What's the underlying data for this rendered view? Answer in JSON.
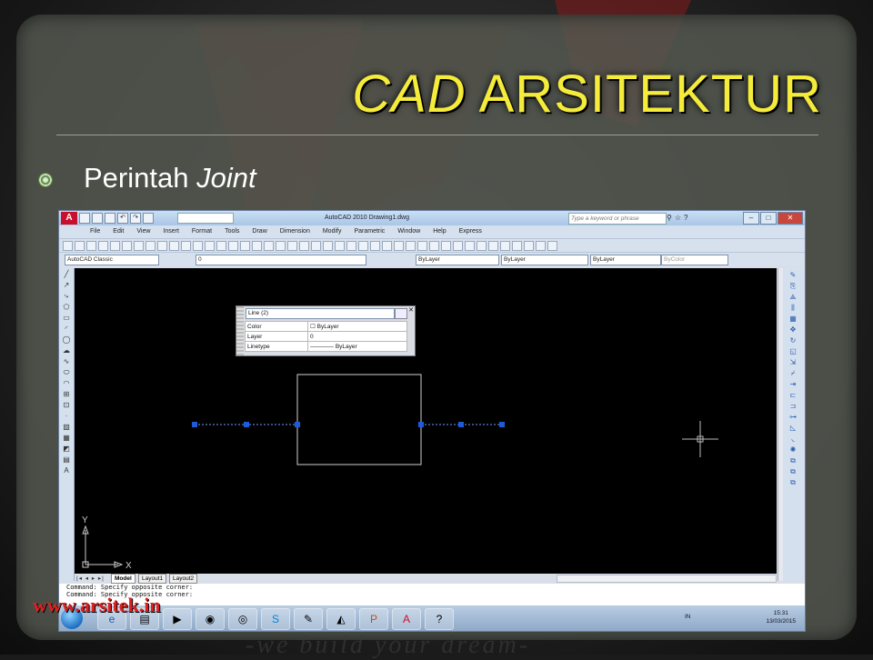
{
  "slide": {
    "title_italic": "CAD",
    "title_rest": "ARSITEKTUR",
    "bullet_text": "Perintah",
    "bullet_italic": "Joint"
  },
  "autocad": {
    "app_logo": "A",
    "workspace_dropdown": "",
    "window_title": "AutoCAD 2010      Drawing1.dwg",
    "search_placeholder": "Type a keyword or phrase",
    "menus": [
      "File",
      "Edit",
      "View",
      "Insert",
      "Format",
      "Tools",
      "Draw",
      "Dimension",
      "Modify",
      "Parametric",
      "Window",
      "Help",
      "Express"
    ],
    "workspace": "AutoCAD Classic",
    "layer_value": "0",
    "color_control": "ByLayer",
    "linetype_control": "ByLayer",
    "lineweight_control": "ByLayer",
    "plotstyle_control": "ByColor",
    "tabs": [
      "Model",
      "Layout1",
      "Layout2"
    ],
    "tab_nav": "|◂ ◂ ▸ ▸|",
    "command_lines": [
      "Command: Specify opposite corner:",
      "Command: Specify opposite corner:"
    ],
    "properties": {
      "selection": "Line (2)",
      "rows": [
        {
          "label": "Color",
          "value": "ByLayer"
        },
        {
          "label": "Layer",
          "value": "0"
        },
        {
          "label": "Linetype",
          "value": "ByLayer"
        }
      ]
    },
    "ucs": {
      "x_label": "X",
      "y_label": "Y"
    },
    "taskbar": {
      "lang": "IN",
      "time": "15:31",
      "date": "13/03/2015"
    }
  },
  "watermark": "www.arsitek.in",
  "slogan": "-we build your dream-",
  "colors": {
    "title": "#f4eb3a",
    "grip": "#1e5bd8",
    "watermark": "#e02020"
  }
}
